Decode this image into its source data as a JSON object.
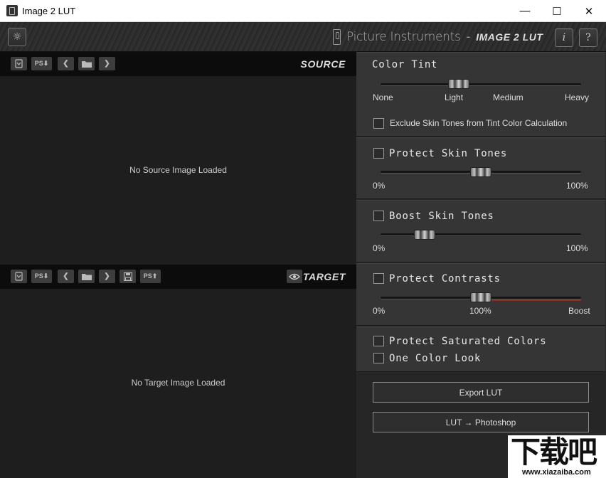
{
  "window": {
    "title": "Image 2 LUT",
    "minimize": "—",
    "maximize": "☐",
    "close": "✕"
  },
  "header": {
    "settings_icon": "☼",
    "company": "Picture Instruments",
    "dash": "-",
    "product": "IMAGE 2 LUT",
    "info_label": "i",
    "help_label": "?"
  },
  "source": {
    "label": "SOURCE",
    "placeholder": "No Source Image Loaded",
    "buttons": {
      "ps_import": "PS⬇",
      "prev": "❮",
      "next": "❯"
    }
  },
  "target": {
    "label": "TARGET",
    "placeholder": "No Target Image Loaded",
    "buttons": {
      "ps_import": "PS⬇",
      "prev": "❮",
      "next": "❯",
      "ps_export": "PS⬆"
    }
  },
  "color_tint": {
    "title": "Color Tint",
    "labels": [
      "None",
      "Light",
      "Medium",
      "Heavy"
    ],
    "value": 0.39,
    "exclude_label": "Exclude Skin Tones from Tint Color Calculation",
    "exclude_checked": false
  },
  "protect_skin": {
    "title": "Protect Skin Tones",
    "checked": false,
    "min_label": "0%",
    "max_label": "100%",
    "value": 0.5
  },
  "boost_skin": {
    "title": "Boost Skin Tones",
    "checked": false,
    "min_label": "0%",
    "max_label": "100%",
    "value": 0.22
  },
  "protect_contrasts": {
    "title": "Protect Contrasts",
    "checked": false,
    "min_label": "0%",
    "mid_label": "100%",
    "max_label": "Boost",
    "value": 0.5
  },
  "options": {
    "saturated_label": "Protect Saturated Colors",
    "saturated_checked": false,
    "one_color_label": "One Color Look",
    "one_color_checked": false
  },
  "actions": {
    "export_lut": "Export LUT",
    "lut_photoshop": "LUT → Photoshop"
  },
  "watermark": {
    "text": "下载吧",
    "url": "www.xiazaiba.com"
  }
}
